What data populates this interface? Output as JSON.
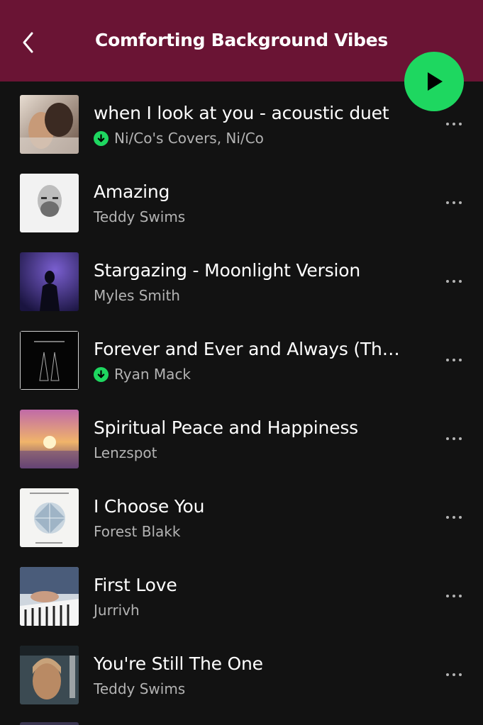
{
  "header": {
    "title": "Comforting Background Vibes",
    "background": "#6a1434",
    "back_icon": "chevron-left-icon",
    "play_icon": "play-icon",
    "play_color": "#1ed760"
  },
  "tracks": [
    {
      "title": "when I look at you - acoustic duet",
      "artist": "Ni/Co's Covers, Ni/Co",
      "downloaded": true
    },
    {
      "title": "Amazing",
      "artist": "Teddy Swims",
      "downloaded": false
    },
    {
      "title": "Stargazing - Moonlight Version",
      "artist": "Myles Smith",
      "downloaded": false
    },
    {
      "title": "Forever and Ever and Always (The...",
      "artist": "Ryan Mack",
      "downloaded": true
    },
    {
      "title": "Spiritual Peace and Happiness",
      "artist": "Lenzspot",
      "downloaded": false
    },
    {
      "title": "I Choose You",
      "artist": "Forest Blakk",
      "downloaded": false
    },
    {
      "title": "First Love",
      "artist": "Jurrivh",
      "downloaded": false
    },
    {
      "title": "You're Still The One",
      "artist": "Teddy Swims",
      "downloaded": false
    }
  ]
}
